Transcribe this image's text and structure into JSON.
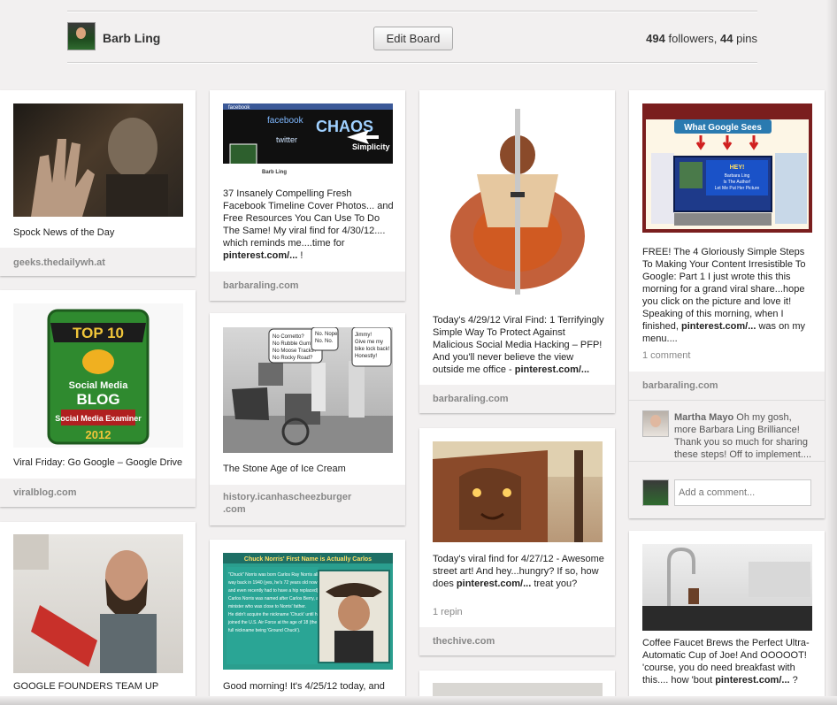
{
  "header": {
    "owner_name": "Barb Ling",
    "edit_button": "Edit Board",
    "followers_count": "494",
    "followers_label": "followers,",
    "pins_count": "44",
    "pins_label": "pins"
  },
  "pins": {
    "spock": {
      "desc": "Spock News of the Day",
      "source": "geeks.thedailywh.at"
    },
    "facebook": {
      "desc": "37 Insanely Compelling Fresh Facebook Timeline Cover Photos... and Free Resources You Can Use To Do The Same! My viral find for 4/30/12.... which reminds me....time for ",
      "link": "pinterest.com/...",
      "tail": " !",
      "source": "barbaraling.com",
      "img_title": "facebook",
      "img_words": "Simplicity",
      "img_name": "Barb Ling"
    },
    "samurai": {
      "desc": "Today's 4/29/12 Viral Find: 1 Terrifyingly Simple Way To Protect Against Malicious Social Media Hacking – PFP! And you'll never believe the view outside me office - ",
      "link": "pinterest.com/...",
      "source": "barbaraling.com"
    },
    "google": {
      "desc": "FREE! The 4 Gloriously Simple Steps To Making Your Content Irresistible To Google: Part 1 I just wrote this this morning for a grand viral share...hope you click on the picture and love it! Speaking of this morning, when I finished, ",
      "link": "pinterest.com/...",
      "tail": " was on my menu....",
      "comments": "1 comment",
      "source": "barbaraling.com",
      "img_banner": "What Google Sees",
      "img_hey": "HEY! Barbara Ling Is The Author! Let Me Put Her Picture On The SE Results!",
      "commenter": "Martha Mayo",
      "comment_text": " Oh my gosh, more Barbara Ling Brilliance! Thank you so much for sharing these steps! Off to implement....",
      "add_comment_placeholder": "Add a comment..."
    },
    "top10": {
      "desc": "Viral Friday: Go Google – Google Drive",
      "source": "viralblog.com",
      "badge_top": "TOP 10",
      "badge_mid": "Social Media BLOG",
      "badge_sub": "Social Media Examiner",
      "badge_year": "2012"
    },
    "icecream": {
      "desc": "The Stone Age of Ice Cream",
      "source": "history.icanhascheezburger.com",
      "source_line1": "history.icanhascheezburger",
      "source_line2": ".com",
      "bubble1": "No Cornetto? No Rubble Gum? No Moose Tracks? No Rocky Road?",
      "bubble2": "No. Nope. No. No.",
      "bubble3": "Jimmy! Give me my bike lock back! Honestly!"
    },
    "street": {
      "desc": "Today's viral find for 4/27/12 - Awesome street art! And hey...hungry? If so, how does ",
      "link": "pinterest.com/...",
      "tail": " treat you?",
      "repins": "1 repin",
      "source": "thechive.com"
    },
    "googlefounders": {
      "desc": "GOOGLE FOUNDERS TEAM UP WITH JAMES CAMERON FOR ASTEROID"
    },
    "chuck": {
      "img_title": "Chuck Norris' First Name is Actually Carlos",
      "img_text": "\"Chuck\" Norris was born Carlos Ray Norris all the way back in 1940 (yes, he's 72 years old now and even recently had to have a hip replaced). Carlos Norris was named after Carlos Berry, a minister who was close to Norris' father. He didn't acquire the nickname 'Chuck' until he joined the U.S. Air Force at the age of 18 (the full nickname being 'Ground Chuck').",
      "desc": "Good morning! It's 4/25/12 today, and"
    },
    "faucet": {
      "desc": "Coffee Faucet Brews the Perfect Ultra-Automatic Cup of Joe! And OOOOOT! 'course, you do need breakfast with this.... how 'bout ",
      "link": "pinterest.com/...",
      "tail": " ?"
    }
  }
}
